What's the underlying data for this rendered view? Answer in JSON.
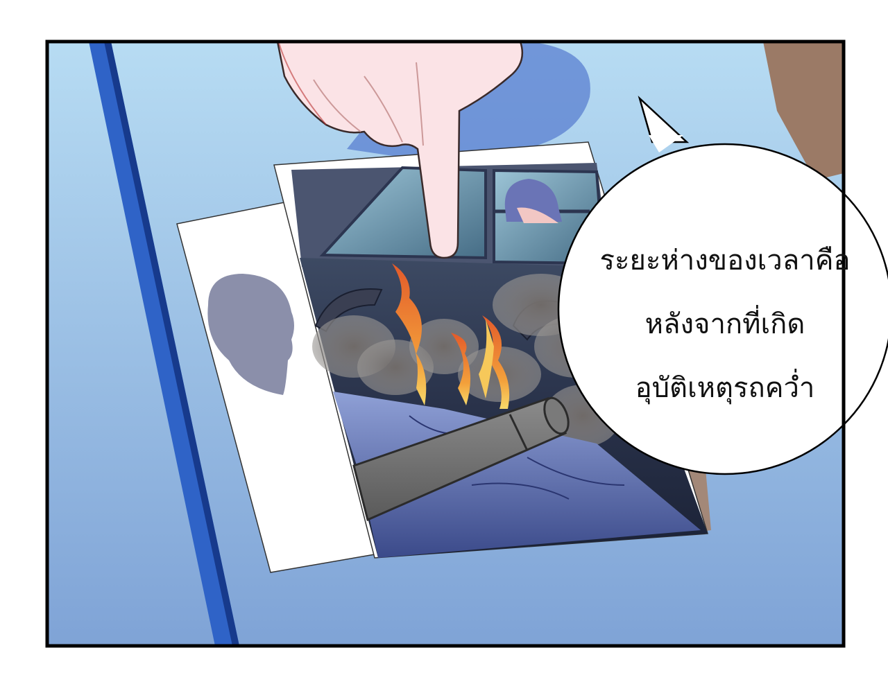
{
  "panel": {
    "speech_bubble": {
      "lines": [
        "ระยะห่างของเวลาคือ",
        "หลังจากที่เกิด",
        "อุบัติเหตุรถคว่ำ"
      ]
    }
  },
  "colors": {
    "background_top": "#b7dcf3",
    "background_bottom": "#7fa3d6",
    "panel_border": "#000000",
    "table_edge_blue": "#2f63c7",
    "skin": "#fbe3e6",
    "smoke": "#5d5b5a",
    "fire": "#f07a35",
    "sheet_paper": "#ffffff",
    "bubble_fill": "#ffffff"
  }
}
